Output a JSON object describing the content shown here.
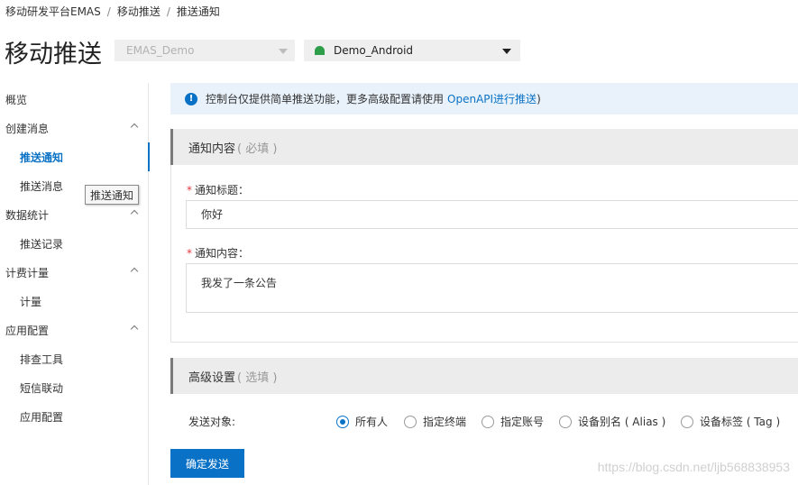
{
  "breadcrumb": [
    "移动研发平台EMAS",
    "移动推送",
    "推送通知"
  ],
  "page_title": "移动推送",
  "app_select": {
    "value": "EMAS_Demo"
  },
  "platform_select": {
    "value": "Demo_Android",
    "icon": "android-icon"
  },
  "sidebar": {
    "items": [
      {
        "label": "概览",
        "level": "top"
      },
      {
        "label": "创建消息",
        "level": "top",
        "expandable": true
      },
      {
        "label": "推送通知",
        "level": "sub",
        "active": true
      },
      {
        "label": "推送消息",
        "level": "sub"
      },
      {
        "label": "数据统计",
        "level": "top",
        "expandable": true
      },
      {
        "label": "推送记录",
        "level": "sub"
      },
      {
        "label": "计费计量",
        "level": "top",
        "expandable": true
      },
      {
        "label": "计量",
        "level": "sub"
      },
      {
        "label": "应用配置",
        "level": "top",
        "expandable": true
      },
      {
        "label": "排查工具",
        "level": "sub"
      },
      {
        "label": "短信联动",
        "level": "sub"
      },
      {
        "label": "应用配置",
        "level": "sub"
      }
    ]
  },
  "tooltip": "推送通知",
  "notice": {
    "text": "控制台仅提供简单推送功能，更多高级配置请使用",
    "link": "OpenAPI进行推送",
    "close_paren": ")"
  },
  "notification_section": {
    "title": "通知内容",
    "hint": "( 必填 )",
    "title_field": {
      "label": "通知标题：",
      "value": "你好"
    },
    "content_field": {
      "label": "通知内容：",
      "value": "我发了一条公告"
    }
  },
  "advanced_section": {
    "title": "高级设置",
    "hint": "( 选填 )",
    "target_label": "发送对象:",
    "targets": [
      {
        "label": "所有人",
        "checked": true
      },
      {
        "label": "指定终端",
        "checked": false
      },
      {
        "label": "指定账号",
        "checked": false
      },
      {
        "label": "设备别名 ( Alias )",
        "checked": false
      },
      {
        "label": "设备标签 ( Tag )",
        "checked": false
      }
    ]
  },
  "submit_label": "确定发送",
  "watermark": "https://blog.csdn.net/ljb568838953",
  "colors": {
    "accent": "#0a72c6",
    "required": "#e5383b",
    "android": "#2e9e4a"
  }
}
